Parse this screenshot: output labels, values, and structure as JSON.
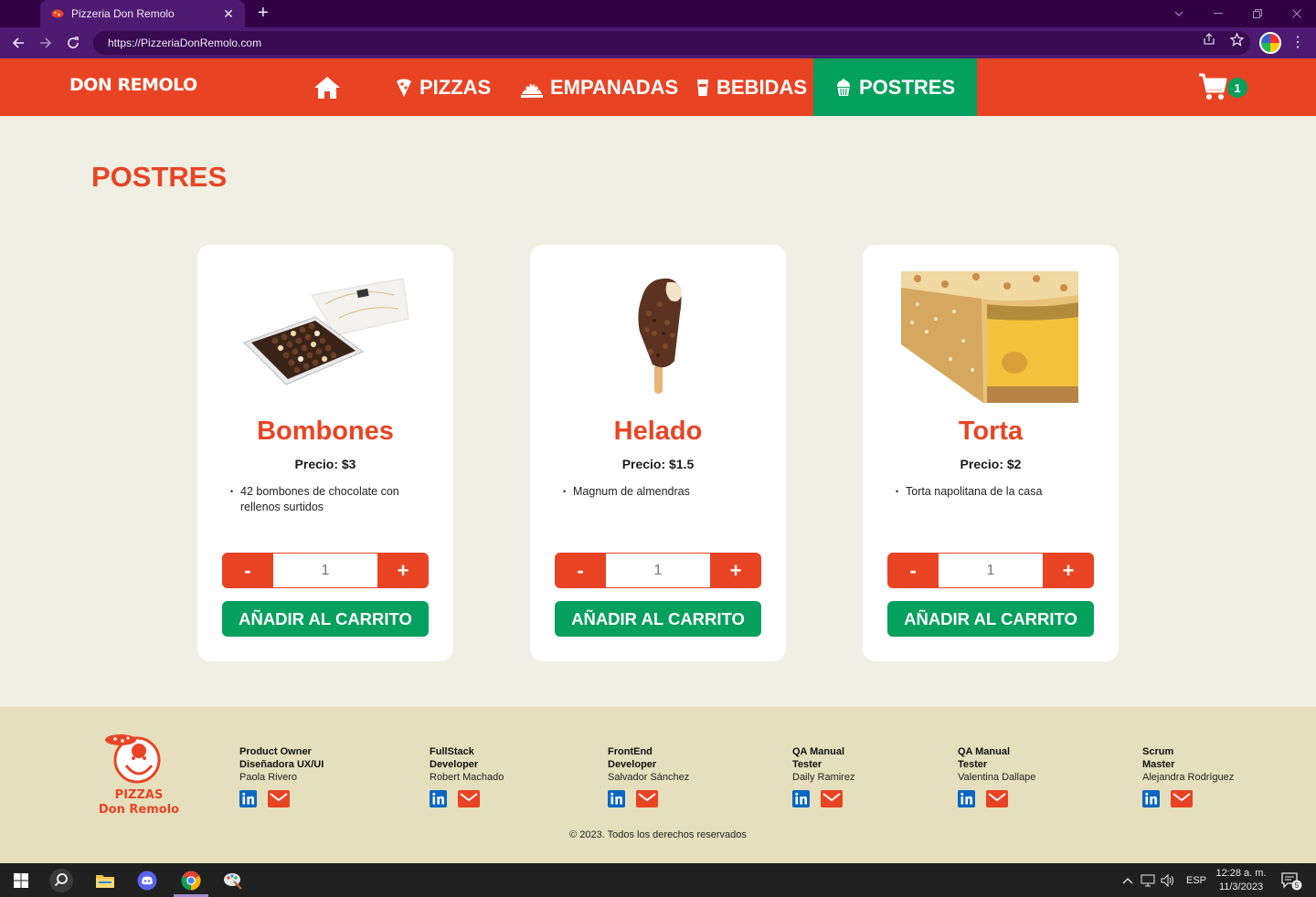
{
  "browser": {
    "tab_title": "Pizzeria Don Remolo",
    "new_tab": "+",
    "close_tab": "✕",
    "url": "https://PizzeriaDonRemolo.com"
  },
  "header": {
    "logo": "DON REMOLO",
    "nav": {
      "pizzas": "PIZZAS",
      "empanadas": "EMPANADAS",
      "bebidas": "BEBIDAS",
      "postres": "POSTRES"
    },
    "cart_count": "1",
    "colors": {
      "primary": "#e84424",
      "active": "#04a05d"
    }
  },
  "page": {
    "title": "POSTRES"
  },
  "products": [
    {
      "name": "Bombones",
      "price": "Precio: $3",
      "desc": "42 bombones de chocolate con rellenos surtidos",
      "qty": "1",
      "minus": "-",
      "plus": "+",
      "add": "AÑADIR AL CARRITO",
      "image_icon": "chocolate-box"
    },
    {
      "name": "Helado",
      "price": "Precio: $1.5",
      "desc": "Magnum de almendras",
      "qty": "1",
      "minus": "-",
      "plus": "+",
      "add": "AÑADIR AL CARRITO",
      "image_icon": "ice-cream"
    },
    {
      "name": "Torta",
      "price": "Precio: $2",
      "desc": "Torta napolitana de la casa",
      "qty": "1",
      "minus": "-",
      "plus": "+",
      "add": "AÑADIR AL CARRITO",
      "image_icon": "cake-slice"
    }
  ],
  "footer": {
    "logo_line1": "PIZZAS",
    "logo_line2": "Don Remolo",
    "members": [
      {
        "role1": "Product Owner",
        "role2": "Diseñadora UX/UI",
        "name": "Paola Rivero"
      },
      {
        "role1": "FullStack",
        "role2": "Developer",
        "name": "Robert Machado"
      },
      {
        "role1": "FrontEnd",
        "role2": "Developer",
        "name": "Salvador Sánchez"
      },
      {
        "role1": "QA Manual",
        "role2": "Tester",
        "name": "Daily Ramirez"
      },
      {
        "role1": "QA Manual",
        "role2": "Tester",
        "name": "Valentina Dallape"
      },
      {
        "role1": "Scrum",
        "role2": "Master",
        "name": "Alejandra Rodríguez"
      }
    ],
    "copyright": "© 2023. Todos los derechos reservados"
  },
  "taskbar": {
    "lang": "ESP",
    "time": "12:28 a. m.",
    "date": "11/3/2023",
    "notifications": "5"
  }
}
